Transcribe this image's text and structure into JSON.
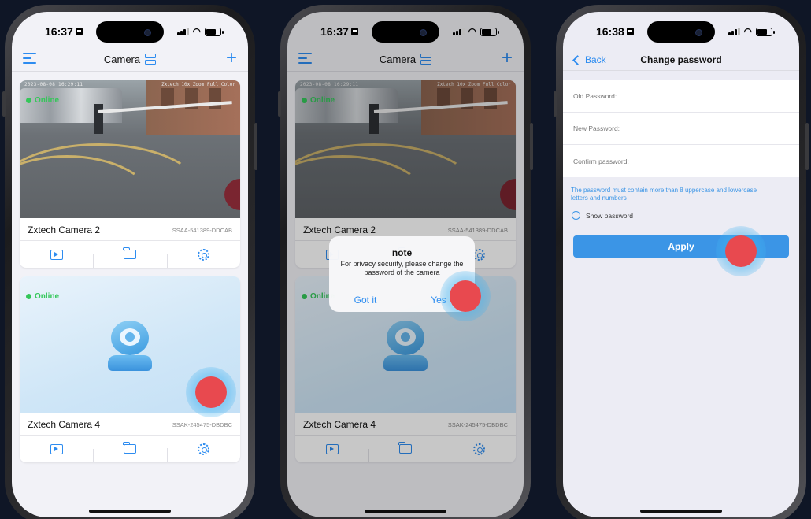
{
  "phone1": {
    "time": "16:37",
    "title": "Camera",
    "cards": [
      {
        "name": "Zxtech Camera 2",
        "serial": "SSAA-541389-DDCAB",
        "status": "Online",
        "overlay_left": "2023-08-08 16:29:11",
        "overlay_right": "Zxtech 10x Zoom Full Color"
      },
      {
        "name": "Zxtech Camera 4",
        "serial": "SSAK-245475-DBDBC",
        "status": "Online"
      }
    ]
  },
  "phone2": {
    "time": "16:37",
    "title": "Camera",
    "cards": [
      {
        "name": "Zxtech Camera 2",
        "serial": "SSAA-541389-DDCAB",
        "status": "Online",
        "overlay_left": "2023-08-08 16:29:11",
        "overlay_right": "Zxtech 10x Zoom Full Color"
      },
      {
        "name": "Zxtech Camera 4",
        "serial": "SSAK-245475-DBDBC",
        "status": "Online"
      }
    ],
    "dialog": {
      "title": "note",
      "message": "For privacy security, please change the password of the camera",
      "cancel": "Got it",
      "confirm": "Yes"
    }
  },
  "phone3": {
    "time": "16:38",
    "back": "Back",
    "title": "Change password",
    "fields": {
      "old": "Old Password:",
      "new": "New Password:",
      "confirm": "Confirm password:"
    },
    "hint": "The password must contain more than 8 uppercase and lowercase letters and numbers",
    "show_password": "Show password",
    "apply": "Apply"
  },
  "colors": {
    "accent": "#2d8cf0",
    "online": "#34c759",
    "touch": "#e8494f",
    "background": "#0f1626"
  }
}
